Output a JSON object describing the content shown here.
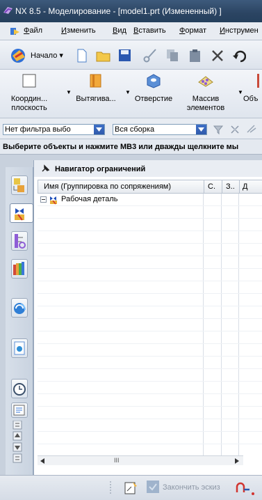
{
  "window": {
    "title": "NX 8.5 - Моделирование - [model1.prt (Измененный) ]"
  },
  "menubar": {
    "items": [
      "Файл",
      "Изменить",
      "Вид",
      "Вставить",
      "Формат",
      "Инструмен"
    ]
  },
  "toolbar1": {
    "start_label": "Начало"
  },
  "toolbar2": {
    "buttons": [
      {
        "label": "Координ... плоскость",
        "line1": "Координ...",
        "line2": "плоскость"
      },
      {
        "label": "Вытягива...",
        "line1": "Вытягива...",
        "line2": ""
      },
      {
        "label": "Отверстие",
        "line1": "Отверстие",
        "line2": ""
      },
      {
        "label": "Массив элементов",
        "line1": "Массив",
        "line2": "элементов"
      },
      {
        "label": "Объ",
        "line1": "Объ",
        "line2": ""
      }
    ]
  },
  "filterbar": {
    "filter_value": "Нет фильтра выбо",
    "scope_value": "Вся сборка"
  },
  "statusline": {
    "prompt": "Выберите объекты и нажмите МВ3 или дважды щелкните мы"
  },
  "navigator": {
    "title": "Навигатор ограничений",
    "columns": [
      "Имя (Группировка по сопряжениям)",
      "С.",
      "З..",
      "Д"
    ],
    "rows": [
      {
        "name": "Рабочая деталь"
      }
    ],
    "scroll_grip": "III"
  },
  "bottom_toolbar": {
    "finish_sketch_label": "Закончить эскиз"
  },
  "colors": {
    "title_bar": "#2b4462",
    "accent_blue": "#2f5aab",
    "panel_bg": "#e8ecf2"
  }
}
